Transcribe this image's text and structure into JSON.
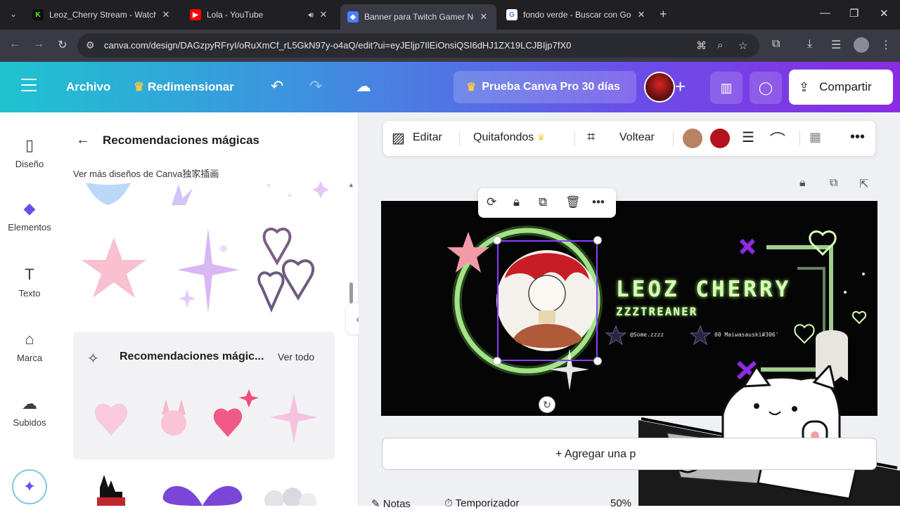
{
  "browser": {
    "tabs": [
      {
        "title": "Leoz_Cherry Stream - Watch Li...",
        "favicon": "kick-icon",
        "color": "#53fc18"
      },
      {
        "title": "Lola - YouTube",
        "favicon": "youtube-icon",
        "color": "#ff0000"
      },
      {
        "title": "Banner para Twitch Gamer Neó...",
        "favicon": "canva-shield-icon",
        "color": "#4f7cff"
      },
      {
        "title": "fondo verde - Buscar con Goog...",
        "favicon": "google-icon",
        "color": "#ffffff"
      }
    ],
    "url": "canva.com/design/DAGzpyRFryI/oRuXmCf_rL5GkN97y-o4aQ/edit?ui=eyJEljp7IlEiOnsiQSI6dHJ1ZX19LCJBIjp7fX0"
  },
  "header": {
    "file_label": "Archivo",
    "resize_label": "Redimensionar",
    "pro_label": "Prueba Canva Pro 30 días",
    "share_label": "Compartir"
  },
  "rail": {
    "items": [
      {
        "label": "Diseño",
        "icon": "layout-icon"
      },
      {
        "label": "Elementos",
        "icon": "elements-icon"
      },
      {
        "label": "Texto",
        "icon": "text-icon"
      },
      {
        "label": "Marca",
        "icon": "brand-icon"
      },
      {
        "label": "Subidos",
        "icon": "cloud-upload-icon"
      }
    ]
  },
  "panel": {
    "title": "Recomendaciones mágicas",
    "subtitle": "Ver más diseños de Canva独家插画",
    "card_title": "Recomendaciones mágic...",
    "card_link": "Ver todo"
  },
  "context_toolbar": {
    "edit": "Editar",
    "bg_remove": "Quitafondos",
    "flip": "Voltear",
    "swatch_1": "#b98262",
    "swatch_2": "#b3121e"
  },
  "banner": {
    "title": "LEOZ CHERRY",
    "subtitle": "ZZZTREANER",
    "handle_1": "@Some.zzzz",
    "handle_2": "00 Maiwasauski#306'"
  },
  "canvas": {
    "add_page": "+ Agregar una p"
  },
  "footer": {
    "notes": "Notas",
    "timer": "Temporizador",
    "zoom": "50%"
  }
}
